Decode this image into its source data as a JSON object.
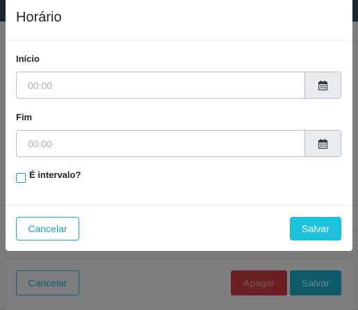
{
  "modal": {
    "title": "Horário",
    "start": {
      "label": "Início",
      "placeholder": "00:00",
      "icon": "calendar-icon"
    },
    "end": {
      "label": "Fim",
      "placeholder": "00:00",
      "icon": "calendar-icon"
    },
    "break_checkbox": {
      "label": "É intervalo?",
      "checked": false
    },
    "cancel_label": "Cancelar",
    "save_label": "Salvar"
  },
  "background": {
    "cancel_label": "Cancelar",
    "delete_label": "Apagar",
    "save_label": "Salvar"
  },
  "colors": {
    "accent": "#17a2b8",
    "save_button": "#1ec2dc",
    "danger": "#dc3545"
  }
}
